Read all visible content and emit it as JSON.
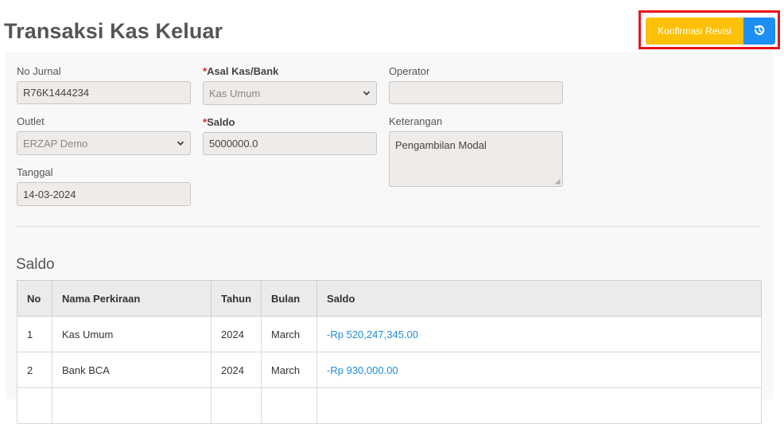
{
  "page": {
    "title": "Transaksi Kas Keluar"
  },
  "actions": {
    "confirm_label": "Konfirmasi Revisi",
    "revert_icon": "history-icon"
  },
  "form": {
    "no_jurnal": {
      "label": "No Jurnal",
      "value": "R76K1444234"
    },
    "outlet": {
      "label": "Outlet",
      "value": "ERZAP Demo"
    },
    "tanggal": {
      "label": "Tanggal",
      "value": "14-03-2024"
    },
    "asal_kas": {
      "star": "*",
      "label": "Asal Kas/Bank",
      "value": "Kas Umum"
    },
    "saldo": {
      "star": "*",
      "label": "Saldo",
      "value": "5000000.0"
    },
    "operator": {
      "label": "Operator",
      "value": ""
    },
    "keterangan": {
      "label": "Keterangan",
      "value": "Pengambilan Modal"
    }
  },
  "saldo_section": {
    "title": "Saldo",
    "headers": [
      "No",
      "Nama Perkiraan",
      "Tahun",
      "Bulan",
      "Saldo"
    ],
    "rows": [
      [
        "1",
        "Kas Umum",
        "2024",
        "March",
        "-Rp 520,247,345.00"
      ],
      [
        "2",
        "Bank BCA",
        "2024",
        "March",
        "-Rp 930,000.00"
      ],
      [
        "",
        "",
        "",
        "",
        ""
      ]
    ]
  },
  "colors": {
    "confirm": "#ffc107",
    "revert": "#1e8ff2",
    "highlight": "#e8141b",
    "amount": "#1f8dd6"
  }
}
